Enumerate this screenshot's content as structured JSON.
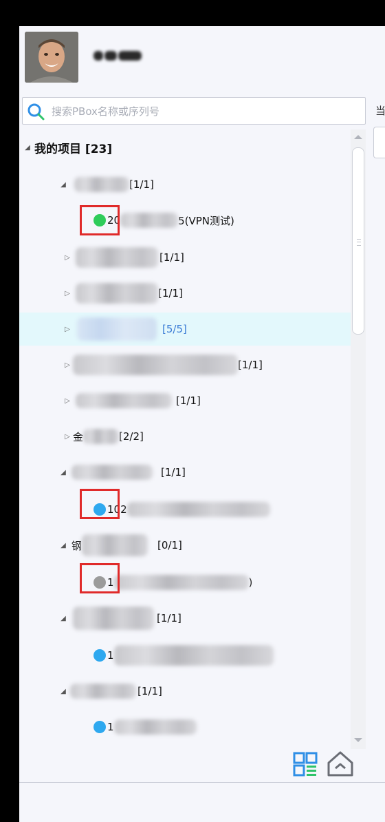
{
  "search": {
    "placeholder": "搜索PBox名称或序列号"
  },
  "right_pane": {
    "label": "当"
  },
  "tree": {
    "root": {
      "label": "我的项目 [23]"
    },
    "rows": [
      {
        "prefix": "",
        "count": " [1/1]"
      },
      {
        "prefix": "20",
        "suffix": "5(VPN测试)",
        "status": "online",
        "status_color": "#2ecc5a"
      },
      {
        "prefix": "",
        "count": "[1/1]"
      },
      {
        "prefix": "",
        "count": " [1/1]"
      },
      {
        "prefix": "",
        "count": "[5/5]"
      },
      {
        "prefix": "",
        "count": " [1/1]"
      },
      {
        "prefix": "",
        "count": "[1/1]"
      },
      {
        "prefix": "金",
        "count": " [2/2]"
      },
      {
        "prefix": "",
        "count": "[1/1]"
      },
      {
        "prefix": "102",
        "suffix": "",
        "status": "normal",
        "status_color": "#2ea8ef"
      },
      {
        "prefix": "钢",
        "count": "[0/1]"
      },
      {
        "prefix": "1",
        "suffix": ")",
        "status": "offline",
        "status_color": "#9b9b9b"
      },
      {
        "prefix": "",
        "count": "[1/1]"
      },
      {
        "prefix": "1",
        "suffix": "",
        "status": "normal",
        "status_color": "#2ea8ef"
      },
      {
        "prefix": "",
        "count": "[1/1]"
      },
      {
        "prefix": "1",
        "suffix": "",
        "status": "normal",
        "status_color": "#2ea8ef"
      }
    ]
  },
  "icons": {
    "search": "search-icon",
    "qr": "qr-code-icon",
    "home": "home-icon",
    "expanded": "triangle-expanded-icon",
    "collapsed": "triangle-collapsed-icon"
  },
  "colors": {
    "accent": "#2f8fe6",
    "online": "#2ecc5a",
    "normal": "#2ea8ef",
    "offline": "#9b9b9b",
    "highlight_box": "#e02a2a",
    "selected_row": "#e3f8fc"
  }
}
